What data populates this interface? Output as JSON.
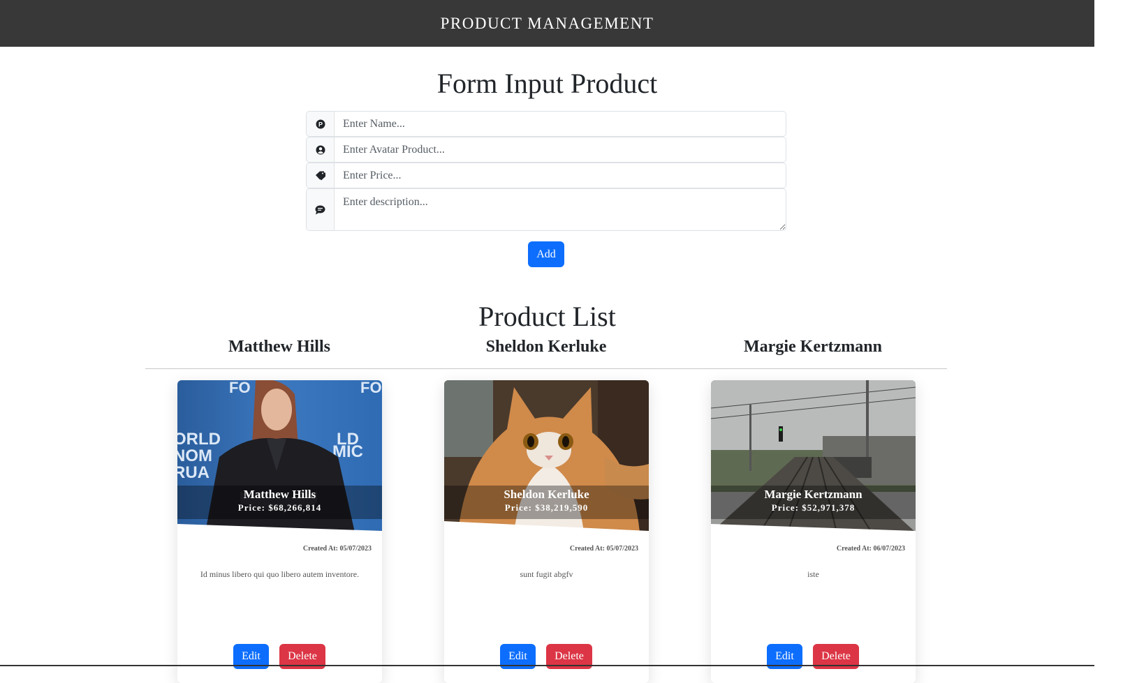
{
  "header": {
    "title": "PRODUCT MANAGEMENT"
  },
  "form": {
    "title": "Form Input Product",
    "fields": [
      {
        "icon": "product-p-icon",
        "placeholder": "Enter Name...",
        "value": ""
      },
      {
        "icon": "user-circle-icon",
        "placeholder": "Enter Avatar Product...",
        "value": ""
      },
      {
        "icon": "tags-icon",
        "placeholder": "Enter Price...",
        "value": ""
      },
      {
        "icon": "message-icon",
        "placeholder": "Enter description...",
        "value": ""
      }
    ],
    "add_label": "Add"
  },
  "list": {
    "title": "Product List",
    "products": [
      {
        "name": "Matthew Hills",
        "price": "Price: $68,266,814",
        "created": "Created At: 05/07/2023",
        "description": "Id minus libero qui quo libero autem inventore.",
        "image": "woman-at-forum-photo",
        "edit_label": "Edit",
        "delete_label": "Delete"
      },
      {
        "name": "Sheldon Kerluke",
        "price": "Price: $38,219,590",
        "created": "Created At: 05/07/2023",
        "description": "sunt fugit abgfv",
        "image": "cat-photo",
        "edit_label": "Edit",
        "delete_label": "Delete"
      },
      {
        "name": "Margie Kertzmann",
        "price": "Price: $52,971,378",
        "created": "Created At: 06/07/2023",
        "description": "iste",
        "image": "railway-photo",
        "edit_label": "Edit",
        "delete_label": "Delete"
      }
    ]
  },
  "colors": {
    "header_bg": "#383838",
    "primary": "#0d6efd",
    "danger": "#dc3545"
  }
}
